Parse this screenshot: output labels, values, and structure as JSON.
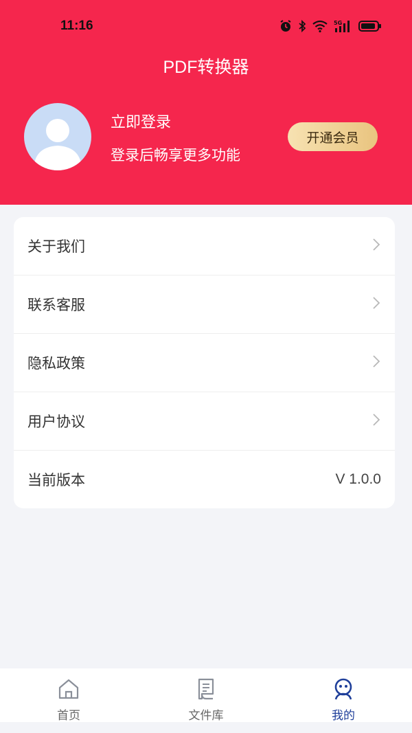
{
  "status_bar": {
    "time": "11:16",
    "icons": [
      "alarm-icon",
      "bluetooth-icon",
      "wifi-icon",
      "5g-signal-icon",
      "battery-icon"
    ]
  },
  "header": {
    "title": "PDF转换器",
    "background_color": "#f5264d"
  },
  "profile": {
    "login_title": "立即登录",
    "login_subtitle": "登录后畅享更多功能",
    "vip_button_label": "开通会员"
  },
  "menu": {
    "items": [
      {
        "label": "关于我们",
        "icon": "chevron-right-icon"
      },
      {
        "label": "联系客服",
        "icon": "chevron-right-icon"
      },
      {
        "label": "隐私政策",
        "icon": "chevron-right-icon"
      },
      {
        "label": "用户协议",
        "icon": "chevron-right-icon"
      },
      {
        "label": "当前版本",
        "value": "V 1.0.0"
      }
    ]
  },
  "tabbar": {
    "tabs": [
      {
        "label": "首页",
        "icon": "home-icon",
        "active": false
      },
      {
        "label": "文件库",
        "icon": "file-library-icon",
        "active": false
      },
      {
        "label": "我的",
        "icon": "profile-robot-icon",
        "active": true
      }
    ],
    "active_color": "#1f3f9a"
  }
}
